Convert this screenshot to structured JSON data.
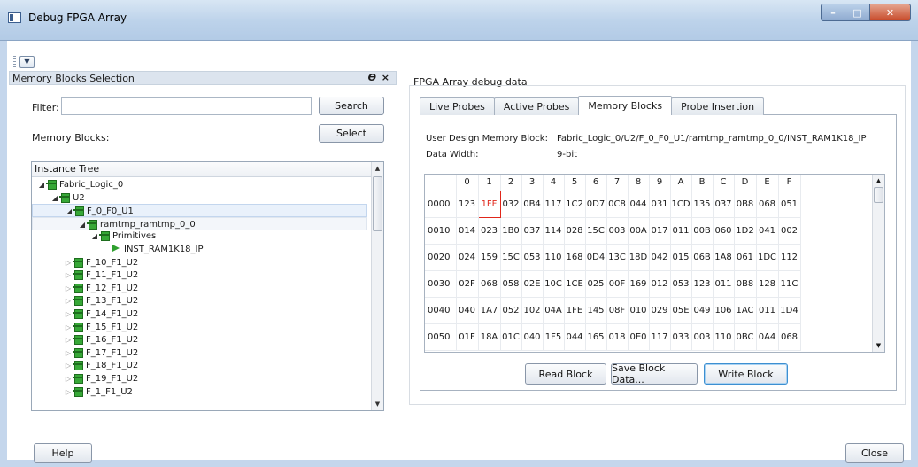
{
  "window": {
    "title": "Debug FPGA Array"
  },
  "dock": {
    "title": "Memory Blocks Selection",
    "float_glyph": "Ε",
    "close_glyph": "×",
    "filter_label": "Filter:",
    "filter_value": "",
    "search_label": "Search",
    "memory_blocks_label": "Memory Blocks:",
    "select_label": "Select",
    "tree_header": "Instance Tree",
    "tree": [
      {
        "label": "Fabric_Logic_0",
        "depth": 0,
        "icon": "node",
        "expanded": true
      },
      {
        "label": "U2",
        "depth": 1,
        "icon": "node",
        "expanded": true
      },
      {
        "label": "F_0_F0_U1",
        "depth": 2,
        "icon": "node",
        "expanded": true,
        "selected": "sel"
      },
      {
        "label": "ramtmp_ramtmp_0_0",
        "depth": 3,
        "icon": "node",
        "expanded": true,
        "selected": "sel2"
      },
      {
        "label": "Primitives",
        "depth": 4,
        "icon": "node",
        "expanded": true
      },
      {
        "label": "INST_RAM1K18_IP",
        "depth": 5,
        "icon": "leaf"
      },
      {
        "label": "F_10_F1_U2",
        "depth": 2,
        "icon": "node",
        "expanded": false
      },
      {
        "label": "F_11_F1_U2",
        "depth": 2,
        "icon": "node",
        "expanded": false
      },
      {
        "label": "F_12_F1_U2",
        "depth": 2,
        "icon": "node",
        "expanded": false
      },
      {
        "label": "F_13_F1_U2",
        "depth": 2,
        "icon": "node",
        "expanded": false
      },
      {
        "label": "F_14_F1_U2",
        "depth": 2,
        "icon": "node",
        "expanded": false
      },
      {
        "label": "F_15_F1_U2",
        "depth": 2,
        "icon": "node",
        "expanded": false
      },
      {
        "label": "F_16_F1_U2",
        "depth": 2,
        "icon": "node",
        "expanded": false
      },
      {
        "label": "F_17_F1_U2",
        "depth": 2,
        "icon": "node",
        "expanded": false
      },
      {
        "label": "F_18_F1_U2",
        "depth": 2,
        "icon": "node",
        "expanded": false
      },
      {
        "label": "F_19_F1_U2",
        "depth": 2,
        "icon": "node",
        "expanded": false
      },
      {
        "label": "F_1_F1_U2",
        "depth": 2,
        "icon": "node",
        "expanded": false
      }
    ]
  },
  "main": {
    "group_title": "FPGA Array debug data",
    "tabs": [
      {
        "label": "Live Probes",
        "active": false
      },
      {
        "label": "Active Probes",
        "active": false
      },
      {
        "label": "Memory Blocks",
        "active": true
      },
      {
        "label": "Probe Insertion",
        "active": false
      }
    ],
    "udmb_label": "User Design Memory Block:",
    "udmb_value": "Fabric_Logic_0/U2/F_0_F0_U1/ramtmp_ramtmp_0_0/INST_RAM1K18_IP",
    "data_width_label": "Data Width:",
    "data_width_value": "9-bit",
    "columns": [
      "0",
      "1",
      "2",
      "3",
      "4",
      "5",
      "6",
      "7",
      "8",
      "9",
      "A",
      "B",
      "C",
      "D",
      "E",
      "F"
    ],
    "rows": [
      {
        "addr": "0000",
        "cells": [
          "123",
          "1FF",
          "032",
          "0B4",
          "117",
          "1C2",
          "0D7",
          "0C8",
          "044",
          "031",
          "1CD",
          "135",
          "037",
          "0B8",
          "068",
          "051"
        ]
      },
      {
        "addr": "0010",
        "cells": [
          "014",
          "023",
          "1B0",
          "037",
          "114",
          "028",
          "15C",
          "003",
          "00A",
          "017",
          "011",
          "00B",
          "060",
          "1D2",
          "041",
          "002"
        ]
      },
      {
        "addr": "0020",
        "cells": [
          "024",
          "159",
          "15C",
          "053",
          "110",
          "168",
          "0D4",
          "13C",
          "18D",
          "042",
          "015",
          "06B",
          "1A8",
          "061",
          "1DC",
          "112"
        ]
      },
      {
        "addr": "0030",
        "cells": [
          "02F",
          "068",
          "058",
          "02E",
          "10C",
          "1CE",
          "025",
          "00F",
          "169",
          "012",
          "053",
          "123",
          "011",
          "0B8",
          "128",
          "11C"
        ]
      },
      {
        "addr": "0040",
        "cells": [
          "040",
          "1A7",
          "052",
          "102",
          "04A",
          "1FE",
          "145",
          "08F",
          "010",
          "029",
          "05E",
          "049",
          "106",
          "1AC",
          "011",
          "1D4"
        ]
      },
      {
        "addr": "0050",
        "cells": [
          "01F",
          "18A",
          "01C",
          "040",
          "1F5",
          "044",
          "165",
          "018",
          "0E0",
          "117",
          "033",
          "003",
          "110",
          "0BC",
          "0A4",
          "068"
        ]
      }
    ],
    "highlight": {
      "row": 0,
      "col": 1,
      "color": "#e0261a"
    },
    "read_label": "Read Block",
    "save_label": "Save Block Data...",
    "write_label": "Write Block"
  },
  "footer": {
    "help_label": "Help",
    "close_label": "Close"
  },
  "colors": {
    "accent": "#3d8fd1",
    "node_icon": "#37a837",
    "highlight": "#e0261a"
  }
}
